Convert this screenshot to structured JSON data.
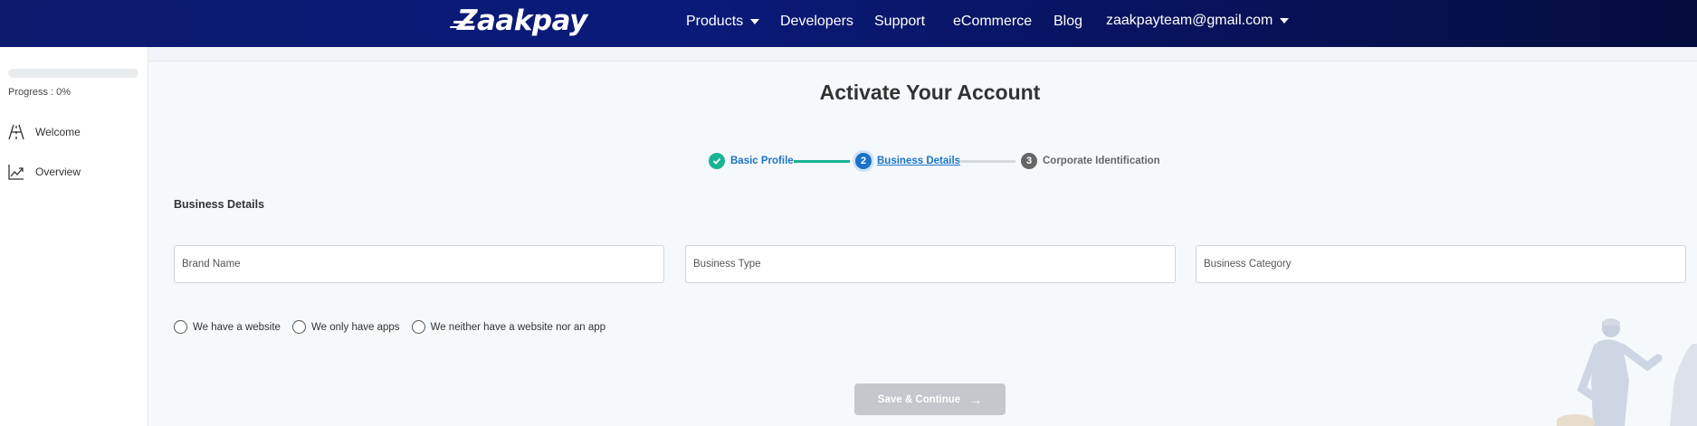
{
  "header": {
    "logo_text": "Zaakpay",
    "nav": [
      {
        "label": "Products",
        "has_dropdown": true
      },
      {
        "label": "Developers"
      },
      {
        "label": "Support"
      },
      {
        "label": "eCommerce"
      },
      {
        "label": "Blog"
      }
    ],
    "account_email": "zaakpayteam@gmail.com"
  },
  "sidebar": {
    "progress_label": "Progress : 0%",
    "progress_value": 0,
    "items": [
      {
        "label": "Welcome",
        "icon": "road-icon"
      },
      {
        "label": "Overview",
        "icon": "trend-chart-icon"
      }
    ]
  },
  "main": {
    "title": "Activate Your Account",
    "stepper": [
      {
        "number": "",
        "label": "Basic Profile",
        "state": "completed"
      },
      {
        "number": "2",
        "label": "Business Details",
        "state": "active"
      },
      {
        "number": "3",
        "label": "Corporate Identification",
        "state": "pending"
      }
    ],
    "section_title": "Business Details",
    "fields": [
      {
        "placeholder": "Brand Name",
        "value": ""
      },
      {
        "placeholder": "Business Type",
        "value": ""
      },
      {
        "placeholder": "Business Category",
        "value": ""
      }
    ],
    "radio_options": [
      "We have a website",
      "We only have apps",
      "We neither have a website nor an app"
    ],
    "save_button": "Save & Continue"
  },
  "colors": {
    "header_bg": "#0a1a7a",
    "completed": "#1ab394",
    "active": "#1a73c8",
    "pending": "#666666",
    "button_disabled": "#c4c7cb"
  }
}
